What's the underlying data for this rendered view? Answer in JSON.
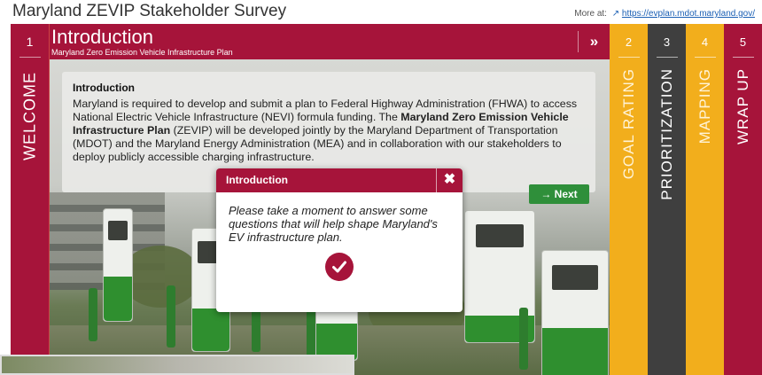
{
  "header": {
    "title": "Maryland ZEVIP Stakeholder Survey",
    "more_at_label": "More at:",
    "more_at_link": "https://evplan.mdot.maryland.gov/"
  },
  "steps": [
    {
      "number": "1",
      "label": "WELCOME",
      "color": "#a6143a"
    },
    {
      "number": "2",
      "label": "GOAL RATING",
      "color": "#f2ae1c"
    },
    {
      "number": "3",
      "label": "PRIORITIZATION",
      "color": "#3f3f3f"
    },
    {
      "number": "4",
      "label": "MAPPING",
      "color": "#f2ae1c"
    },
    {
      "number": "5",
      "label": "WRAP UP",
      "color": "#a6143a"
    }
  ],
  "section": {
    "title": "Introduction",
    "subtitle": "Maryland Zero Emission Vehicle Infrastructure Plan",
    "next_icon": "double-chevron-right-icon"
  },
  "intro": {
    "heading": "Introduction",
    "text_part1": "Maryland is required to develop and submit a plan to Federal Highway Administration (FHWA) to access National Electric Vehicle Infrastructure (NEVI) formula funding. The ",
    "text_bold": "Maryland Zero Emission Vehicle Infrastructure Plan",
    "text_part2": " (ZEVIP) will be developed jointly by the Maryland Department of Transportation (MDOT) and the Maryland Energy Administration (MEA) and in collaboration with our stakeholders to deploy publicly accessible charging infrastructure.",
    "next_label": "→ Next"
  },
  "modal": {
    "title": "Introduction",
    "close_icon": "close-icon",
    "body": "Please take a moment to answer some questions that will help shape Maryland's EV infrastructure plan.",
    "ok_icon": "checkmark-icon"
  },
  "colors": {
    "maroon": "#a6143a",
    "gold": "#f2ae1c",
    "charcoal": "#3f3f3f",
    "green": "#2f8f3a"
  }
}
